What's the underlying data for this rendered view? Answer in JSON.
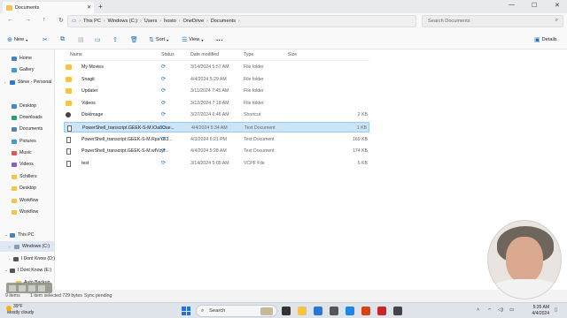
{
  "window": {
    "tab_title": "Documents",
    "new_tab": "+",
    "minimize": "—",
    "maximize": "☐",
    "close": "✕"
  },
  "address": {
    "crumbs": [
      "This PC",
      "Windows (C:)",
      "Users",
      "hosto",
      "OneDrive",
      "Documents"
    ],
    "search_placeholder": "Search Documents"
  },
  "toolbar": {
    "new_label": "New",
    "sort_label": "Sort",
    "view_label": "View",
    "more_label": "···",
    "details_label": "Details"
  },
  "sidebar": {
    "items": [
      {
        "label": "Home"
      },
      {
        "label": "Gallery"
      },
      {
        "label": "Steve - Personal"
      },
      {
        "label": "Desktop"
      },
      {
        "label": "Downloads"
      },
      {
        "label": "Documents"
      },
      {
        "label": "Pictures"
      },
      {
        "label": "Music"
      },
      {
        "label": "Videos"
      },
      {
        "label": "Schillers"
      },
      {
        "label": "Desktop"
      },
      {
        "label": "Workflow"
      },
      {
        "label": "Workflow"
      },
      {
        "label": "This PC"
      },
      {
        "label": "Windows (C:)"
      },
      {
        "label": "I Dont Know (D:)"
      },
      {
        "label": "I Dont Know (E:)"
      },
      {
        "label": "Auto Backup"
      }
    ]
  },
  "columns": {
    "name": "Name",
    "status": "Status",
    "date": "Date modified",
    "type": "Type",
    "size": "Size"
  },
  "files": [
    {
      "name": "My Movies",
      "date": "3/14/2024 5:57 AM",
      "type": "File folder",
      "size": ""
    },
    {
      "name": "Snagit",
      "date": "4/4/2024 5:29 AM",
      "type": "File folder",
      "size": ""
    },
    {
      "name": "Updater",
      "date": "3/11/2024 7:45 AM",
      "type": "File folder",
      "size": ""
    },
    {
      "name": "Videos",
      "date": "3/12/2024 7:18 AM",
      "type": "File folder",
      "size": ""
    },
    {
      "name": "Diskimage",
      "date": "3/27/2024 6:46 AM",
      "type": "Shortcut",
      "size": "2 KB"
    },
    {
      "name": "PowerShell_transcript.GEEK-S-M.lOa8Cue...",
      "date": "4/4/2024 5:34 AM",
      "type": "Text Document",
      "size": "1 KB"
    },
    {
      "name": "PowerShell_transcript.GEEK-S-M.RpaYE3...",
      "date": "4/3/2024 6:21 PM",
      "type": "Text Document",
      "size": "169 KB"
    },
    {
      "name": "PowerShell_transcript.GEEK-S-M.wfVzyf...",
      "date": "4/4/2024 5:28 AM",
      "type": "Text Document",
      "size": "174 KB"
    },
    {
      "name": "test",
      "date": "3/14/2024 5:05 AM",
      "type": "VCPF File",
      "size": "5 KB"
    }
  ],
  "status": {
    "items_count": "9 items",
    "selected": "1 item selected  729 bytes",
    "sync": "Sync pending"
  },
  "taskbar": {
    "temp": "39°F",
    "weather": "Mostly cloudy",
    "search_label": "Search",
    "time": "5:35 AM",
    "date": "4/4/2024"
  }
}
